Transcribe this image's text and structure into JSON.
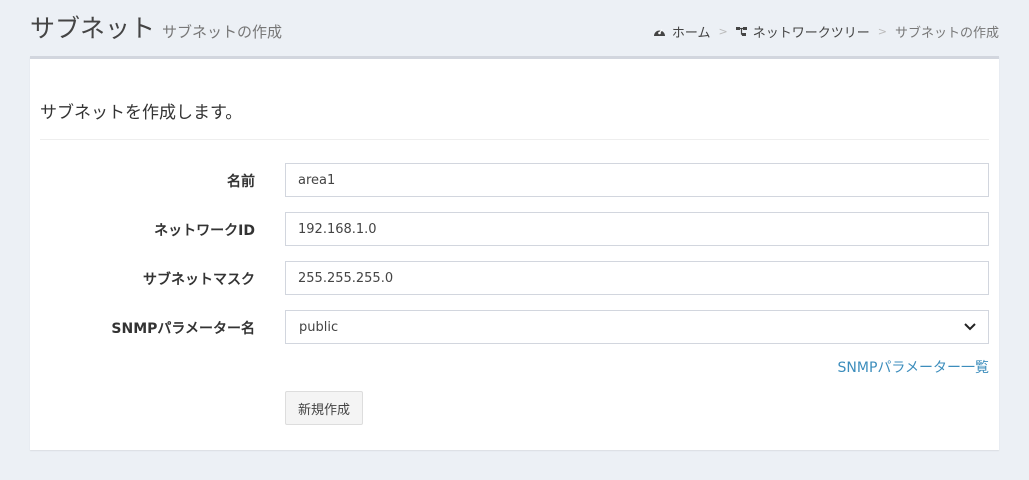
{
  "header": {
    "title": "サブネット",
    "subtitle": "サブネットの作成"
  },
  "breadcrumb": {
    "items": [
      {
        "label": "ホーム",
        "icon": "dashboard-icon"
      },
      {
        "label": "ネットワークツリー",
        "icon": "tree-icon"
      },
      {
        "label": "サブネットの作成"
      }
    ],
    "separator": ">"
  },
  "form": {
    "lead": "サブネットを作成します。",
    "name_label": "名前",
    "name_value": "area1",
    "network_id_label": "ネットワークID",
    "network_id_value": "192.168.1.0",
    "subnet_mask_label": "サブネットマスク",
    "subnet_mask_value": "255.255.255.0",
    "snmp_label": "SNMPパラメーター名",
    "snmp_selected": "public",
    "snmp_list_link": "SNMPパラメーター一覧",
    "submit_label": "新規作成"
  },
  "colors": {
    "background": "#ecf0f5",
    "box_border": "#d2d6de",
    "link": "#3c8dbc"
  }
}
